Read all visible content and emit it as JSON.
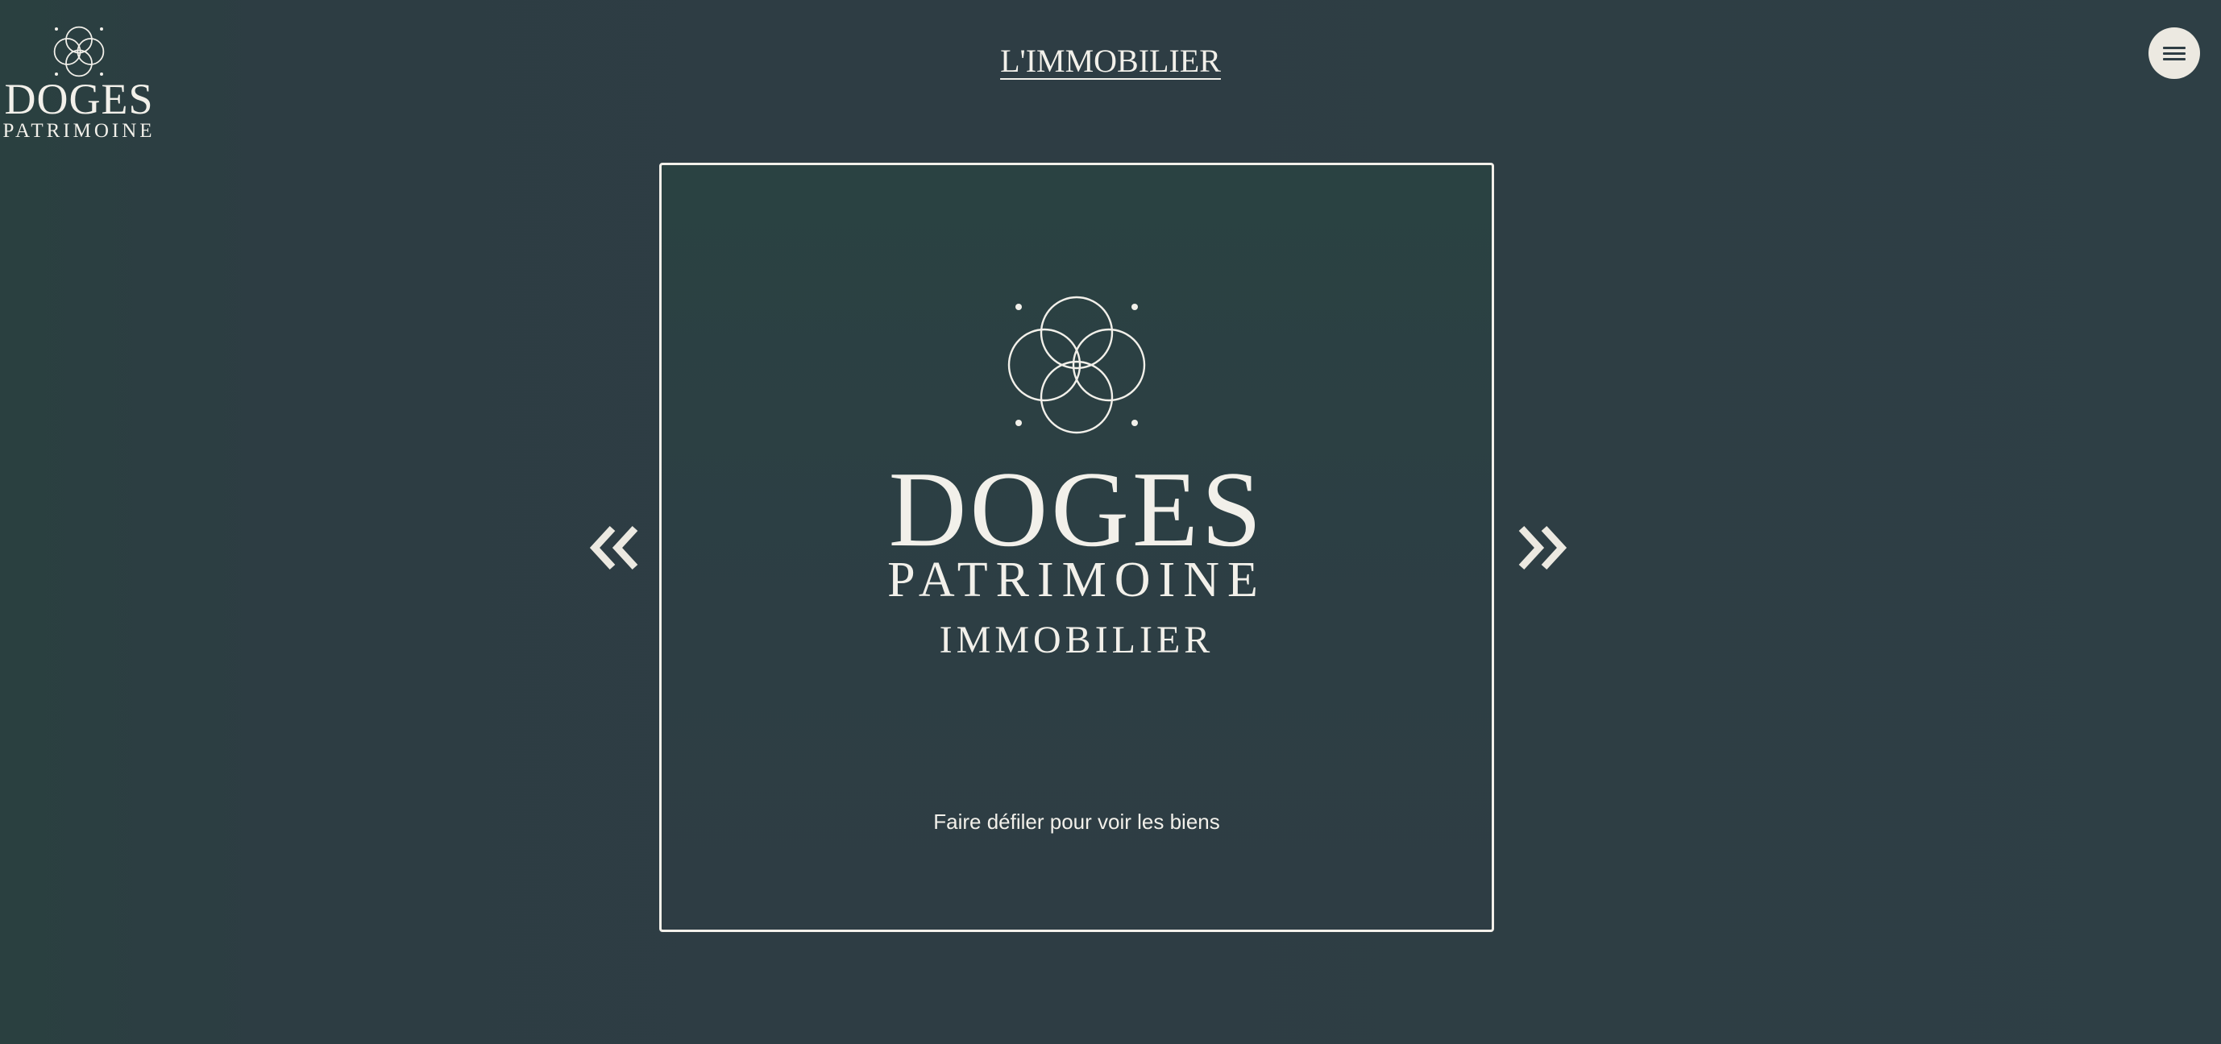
{
  "brand": {
    "name": "DOGES",
    "subtitle": "PATRIMOINE"
  },
  "header": {
    "title": "L'IMMOBILIER"
  },
  "menu": {
    "icon": "hamburger-icon"
  },
  "hero": {
    "brand_name": "DOGES",
    "brand_subtitle": "PATRIMOINE",
    "brand_tag": "IMMOBILIER",
    "scroll_hint": "Faire défiler pour voir les biens"
  },
  "carousel": {
    "prev_icon": "double-chevron-left-icon",
    "next_icon": "double-chevron-right-icon"
  },
  "colors": {
    "background": "#2e3d44",
    "foreground": "#f2f0ea",
    "menu_button": "#ece9e1"
  }
}
